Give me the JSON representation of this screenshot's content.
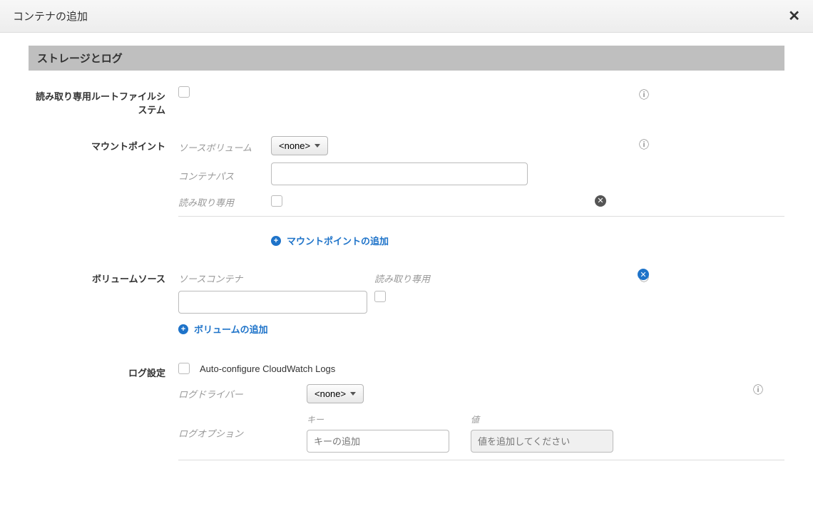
{
  "modal": {
    "title": "コンテナの追加"
  },
  "section": {
    "title": "ストレージとログ"
  },
  "rootfs": {
    "label": "読み取り専用ルートファイルシステム"
  },
  "mount": {
    "label": "マウントポイント",
    "source_volume_label": "ソースボリューム",
    "container_path_label": "コンテナパス",
    "readonly_label": "読み取り専用",
    "none_option": "<none>",
    "add_label": "マウントポイントの追加"
  },
  "volume": {
    "label": "ボリュームソース",
    "source_container_label": "ソースコンテナ",
    "readonly_label": "読み取り専用",
    "add_label": "ボリュームの追加"
  },
  "log": {
    "label": "ログ設定",
    "auto_configure_label": "Auto-configure CloudWatch Logs",
    "driver_label": "ログドライバー",
    "options_label": "ログオプション",
    "none_option": "<none>",
    "key_label": "キー",
    "value_label": "値",
    "key_placeholder": "キーの追加",
    "value_placeholder": "値を追加してください"
  }
}
